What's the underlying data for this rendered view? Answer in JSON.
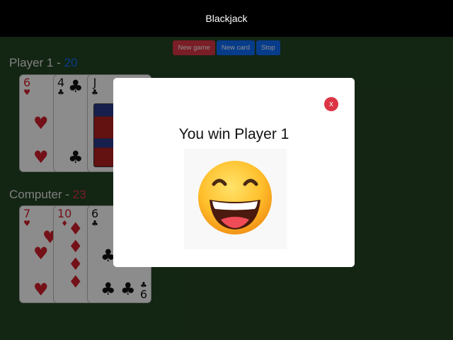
{
  "app": {
    "title": "Blackjack"
  },
  "controls": {
    "new_game": "New game",
    "new_card": "New card",
    "stop": "Stop"
  },
  "player": {
    "label": "Player 1 - ",
    "score": "20",
    "cards": [
      {
        "rank": "6",
        "suit": "♥",
        "color": "red"
      },
      {
        "rank": "4",
        "suit": "♣",
        "color": "black"
      },
      {
        "rank": "J",
        "suit": "♣",
        "color": "black"
      }
    ]
  },
  "computer": {
    "label": "Computer - ",
    "score": "23",
    "cards": [
      {
        "rank": "7",
        "suit": "♥",
        "color": "red"
      },
      {
        "rank": "10",
        "suit": "♦",
        "color": "red"
      },
      {
        "rank": "6",
        "suit": "♣",
        "color": "black"
      }
    ]
  },
  "modal": {
    "title": "You win Player 1",
    "close_label": "x",
    "emoji": "laughing-face-emoji"
  },
  "colors": {
    "background": "#244424",
    "accent_blue": "#0d6efd",
    "accent_red": "#dc3545"
  }
}
